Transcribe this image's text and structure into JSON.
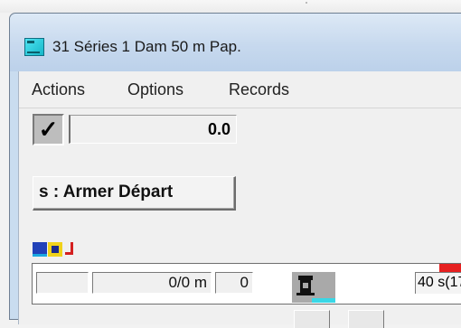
{
  "window": {
    "title": "31 Séries 1  Dam 50 m Pap."
  },
  "menu": {
    "items": [
      "Actions",
      "Options",
      "Records"
    ]
  },
  "controls": {
    "confirm_glyph": "✓",
    "time_value": "0.0",
    "arm_button_label": "s : Armer Départ"
  },
  "status": {
    "distance": "0/0  m",
    "count": "0",
    "timer_text": "40 s(17"
  },
  "icons": [
    "pool-lanes-icon",
    "swimmers-icon",
    "return-arrow-icon",
    "starting-block-icon"
  ],
  "colors": {
    "title_icon": "#16b7c8",
    "alert_red": "#e62020",
    "pool_cyan": "#39d7e6"
  }
}
